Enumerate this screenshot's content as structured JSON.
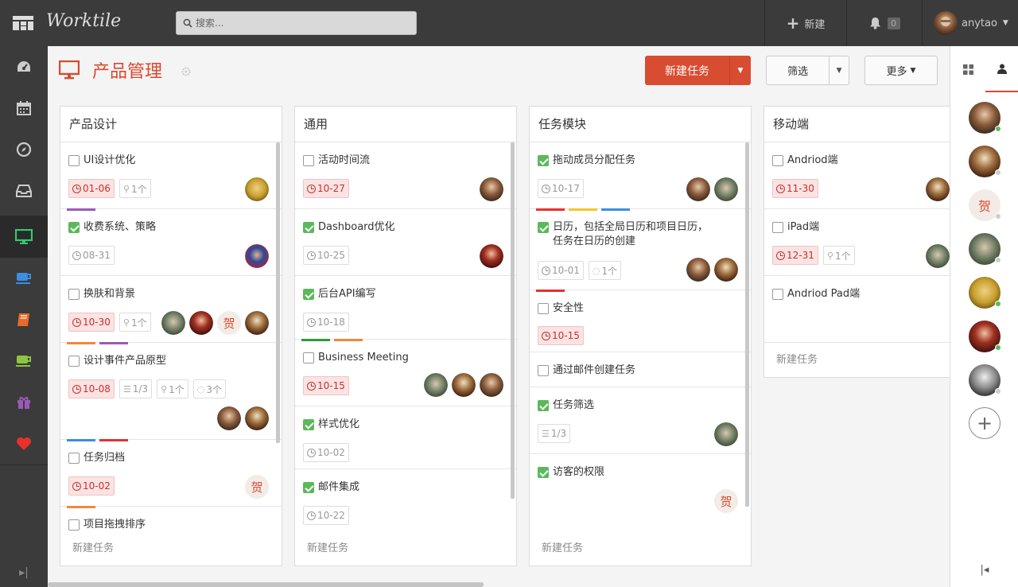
{
  "app": {
    "name": "Worktile"
  },
  "search": {
    "placeholder": "搜索..."
  },
  "topbar": {
    "new_label": "新建",
    "notif_count": "0",
    "user_name": "anytao"
  },
  "project": {
    "title": "产品管理"
  },
  "toolbar": {
    "new_task": "新建任务",
    "filter": "筛选",
    "more": "更多"
  },
  "colors": {
    "accent": "#d84c31",
    "done": "#5cb85c",
    "due_bg": "#fbe3e3",
    "nav_active": "#2ecc71"
  },
  "columns": [
    {
      "title": "产品设计",
      "footer": "新建任务"
    },
    {
      "title": "通用",
      "footer": "新建任务"
    },
    {
      "title": "任务模块",
      "footer": "新建任务"
    },
    {
      "title": "移动端",
      "footer": "新建任务"
    }
  ],
  "tasks": {
    "c0": [
      {
        "title": "UI设计优化",
        "due": "01-06",
        "attach": "1个"
      },
      {
        "title": "收费系统、策略",
        "due": "08-31"
      },
      {
        "title": "换肤和背景",
        "due": "10-30",
        "attach": "1个",
        "he": "贺"
      },
      {
        "title": "设计事件产品原型",
        "due": "10-08",
        "checklist": "1/3",
        "attach": "1个",
        "comments": "3个"
      },
      {
        "title": "任务归档",
        "due": "10-02",
        "he": "贺"
      },
      {
        "title": "项目拖拽排序"
      }
    ],
    "c1": [
      {
        "title": "活动时间流",
        "due": "10-27"
      },
      {
        "title": "Dashboard优化",
        "due": "10-25"
      },
      {
        "title": "后台API编写",
        "due": "10-18"
      },
      {
        "title": "Business Meeting",
        "due": "10-15"
      },
      {
        "title": "样式优化",
        "due": "10-02"
      },
      {
        "title": "邮件集成",
        "due": "10-22"
      }
    ],
    "c2": [
      {
        "title": "拖动成员分配任务",
        "due": "10-17"
      },
      {
        "title_l1": "日历，包括全局日历和项目日历，",
        "title_l2": "任务在日历的创建",
        "due": "10-01",
        "comments": "1个"
      },
      {
        "title": "安全性",
        "due": "10-15"
      },
      {
        "title": "通过邮件创建任务"
      },
      {
        "title": "任务筛选",
        "checklist": "1/3"
      },
      {
        "title": "访客的权限",
        "he": "贺"
      }
    ],
    "c3": [
      {
        "title": "Andriod端",
        "due": "11-30"
      },
      {
        "title": "iPad端",
        "due": "12-31",
        "attach": "1个"
      },
      {
        "title": "Andriod Pad端"
      }
    ]
  },
  "members": {
    "he": "贺"
  },
  "icons": [
    "logo-grid-icon",
    "search-icon",
    "plus-icon",
    "bell-icon",
    "dashboard-icon",
    "calendar-icon",
    "compass-icon",
    "inbox-icon",
    "monitor-icon",
    "coffee-icon",
    "book-icon",
    "cup-icon",
    "gift-icon",
    "heart-icon",
    "gear-icon",
    "clock-icon",
    "paperclip-icon",
    "checklist-icon",
    "comment-icon",
    "grid-icon",
    "user-icon",
    "collapse-icon"
  ]
}
